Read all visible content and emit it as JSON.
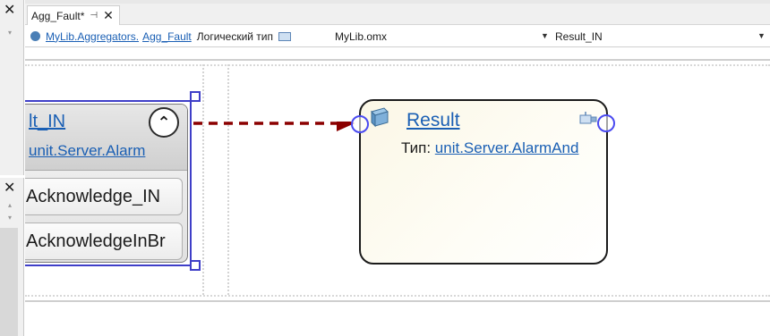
{
  "tabs": [
    {
      "label": "Agg_Fault",
      "modified_marker": "*",
      "pin_glyph": "⊣",
      "close_glyph": "✕"
    }
  ],
  "path": {
    "link_library": "MyLib.Aggregators.",
    "link_item": "Agg_Fault",
    "type_label": "Логический тип",
    "file": "MyLib.omx",
    "selected_port": "Result_IN"
  },
  "left_panels": {
    "close_glyph": "✕"
  },
  "source_node": {
    "title": "lt_IN",
    "type_text": "unit.Server.Alarm",
    "collapse_glyph": "⌃",
    "pins": [
      {
        "label": "Acknowledge_IN"
      },
      {
        "label": "AcknowledgeInBr"
      }
    ]
  },
  "result_node": {
    "title": "Result",
    "type_label": "Тип:",
    "type_value": "unit.Server.AlarmAnd"
  },
  "colors": {
    "link": "#1a5fb4",
    "connection": "#8b0000",
    "selection": "#3e3ec8",
    "port": "#4a4af0"
  }
}
